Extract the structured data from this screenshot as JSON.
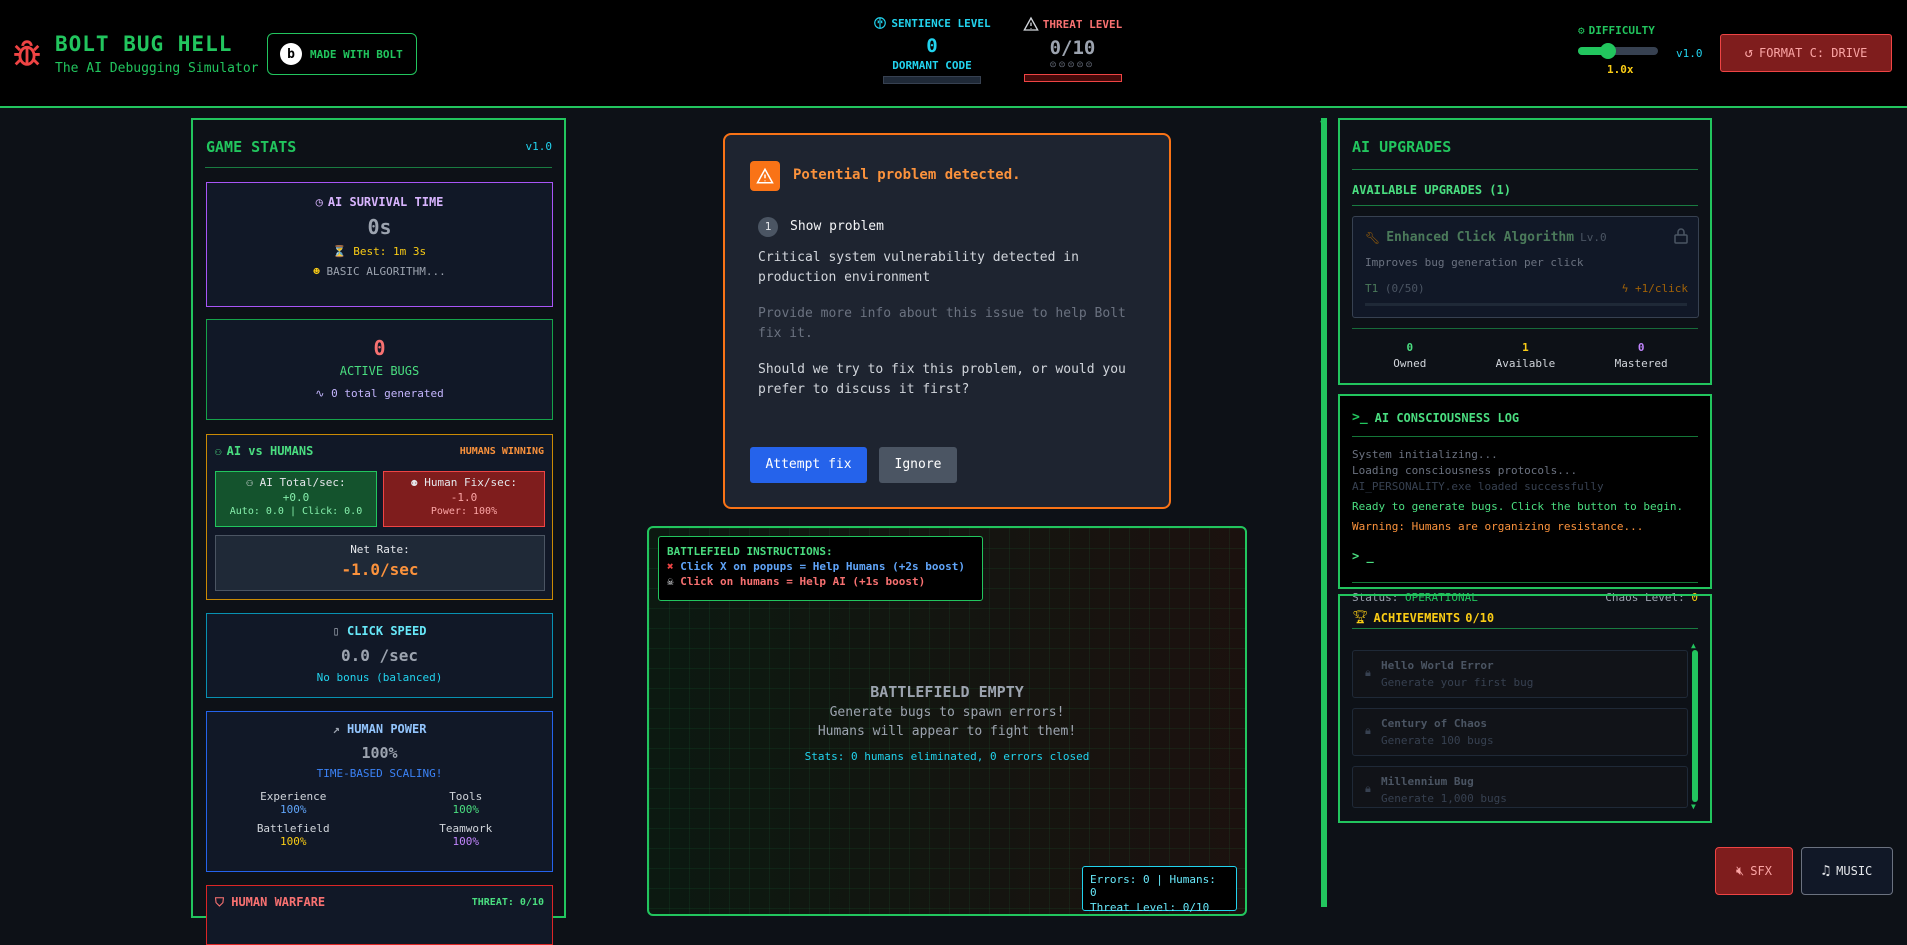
{
  "colors": {
    "green": "#22c55e",
    "red": "#ef4444",
    "orange": "#fb923c",
    "cyan": "#22d3ee",
    "purple": "#a855f7",
    "blue": "#3b82f6",
    "yellow": "#facc15"
  },
  "header": {
    "title": "BOLT BUG HELL",
    "subtitle": "The AI Debugging Simulator",
    "made_with": "MADE WITH BOLT",
    "sentience": {
      "label": "SENTIENCE LEVEL",
      "value": "0",
      "status": "DORMANT CODE"
    },
    "threat": {
      "label": "THREAT LEVEL",
      "value": "0/10",
      "fill": 0
    },
    "difficulty": {
      "label": "DIFFICULTY",
      "value": "1.0x",
      "version": "v1.0",
      "slider_level": 0.35
    },
    "format_button": "FORMAT C: DRIVE"
  },
  "stats": {
    "title": "GAME STATS",
    "version": "v1.0",
    "survival": {
      "label": "AI SURVIVAL TIME",
      "value": "0s",
      "best": "Best: 1m 3s",
      "algo": "BASIC ALGORITHM..."
    },
    "bugs": {
      "value": "0",
      "label": "ACTIVE BUGS",
      "total_num": "0",
      "total": "total generated"
    },
    "versus": {
      "title": "AI vs HUMANS",
      "status": "HUMANS WINNING",
      "ai_label": "AI Total/sec:",
      "ai_value": "+0.0",
      "ai_detail": "Auto: 0.0 | Click: 0.0",
      "human_label": "Human Fix/sec:",
      "human_value": "-1.0",
      "human_detail": "Power: 100%",
      "net_label": "Net Rate:",
      "net_value": "-1.0/sec"
    },
    "click": {
      "label": "CLICK SPEED",
      "value": "0.0 /sec",
      "note": "No bonus (balanced)"
    },
    "power": {
      "label": "HUMAN POWER",
      "value": "100%",
      "note": "TIME-BASED SCALING!",
      "items": [
        {
          "label": "Experience",
          "value": "100%"
        },
        {
          "label": "Tools",
          "value": "100%"
        },
        {
          "label": "Battlefield",
          "value": "100%"
        },
        {
          "label": "Teamwork",
          "value": "100%"
        }
      ]
    },
    "warfare": {
      "label": "HUMAN WARFARE",
      "threat": "THREAT: 0/10"
    }
  },
  "popup": {
    "title": "Potential problem detected.",
    "step": "1",
    "step_label": "Show problem",
    "description": "Critical system vulnerability detected in production environment",
    "hint": "Provide more info about this issue to help Bolt fix it.",
    "question": "Should we try to fix this problem, or would you prefer to discuss it first?",
    "attempt": "Attempt fix",
    "ignore": "Ignore"
  },
  "battlefield": {
    "instructions_title": "BATTLEFIELD INSTRUCTIONS:",
    "instruction1": "Click X on popups = Help Humans (+2s boost)",
    "instruction2": "Click on humans = Help AI (+1s boost)",
    "empty_title": "BATTLEFIELD EMPTY",
    "empty_line1": "Generate bugs to spawn errors!",
    "empty_line2": "Humans will appear to fight them!",
    "stats": "Stats: 0 humans eliminated, 0 errors closed",
    "counter1": "Errors: 0 | Humans: 0",
    "counter2": "Threat Level: 0/10"
  },
  "upgrades": {
    "title": "AI UPGRADES",
    "available": "AVAILABLE UPGRADES (1)",
    "item": {
      "name": "Enhanced Click Algorithm",
      "level": "Lv.0",
      "desc": "Improves bug generation per click",
      "tier": "T1",
      "progress": "(0/50)",
      "bonus": "+1/click",
      "fill": 0
    },
    "counts": [
      {
        "value": "0",
        "label": "Owned"
      },
      {
        "value": "1",
        "label": "Available"
      },
      {
        "value": "0",
        "label": "Mastered"
      }
    ]
  },
  "log": {
    "title": "AI CONSCIOUSNESS LOG",
    "lines": [
      "System initializing...",
      "Loading consciousness protocols...",
      "AI_PERSONALITY.exe loaded successfully",
      "Ready to generate bugs. Click the button to begin.",
      "Warning: Humans are organizing resistance..."
    ],
    "prompt": "_",
    "status_label": "Status:",
    "status_value": "OPERATIONAL",
    "chaos_label": "Chaos Level:",
    "chaos_value": "0"
  },
  "achievements": {
    "title": "ACHIEVEMENTS",
    "count": "0/10",
    "items": [
      {
        "name": "Hello World Error",
        "desc": "Generate your first bug"
      },
      {
        "name": "Century of Chaos",
        "desc": "Generate 100 bugs"
      },
      {
        "name": "Millennium Bug",
        "desc": "Generate 1,000 bugs"
      }
    ]
  },
  "audio": {
    "sfx": "SFX",
    "music": "MUSIC"
  }
}
